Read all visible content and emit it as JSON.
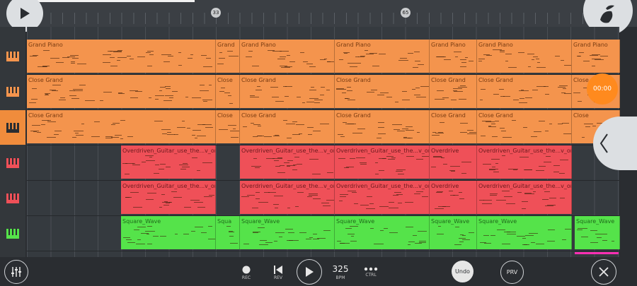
{
  "ruler": {
    "markers": [
      "33",
      "65"
    ]
  },
  "tracks": [
    {
      "icon": "piano-icon",
      "color": "#f4944d"
    },
    {
      "icon": "piano-icon",
      "color": "#f4944d"
    },
    {
      "icon": "piano-icon",
      "color": "#f4944d"
    },
    {
      "icon": "piano-icon",
      "color": "#ef5058"
    },
    {
      "icon": "piano-icon",
      "color": "#ef5058"
    },
    {
      "icon": "piano-icon",
      "color": "#55e34a"
    }
  ],
  "clip_names": {
    "grand_piano": "Grand Piano",
    "grand_short": "Grand",
    "close_grand": "Close Grand",
    "close_short": "Close",
    "guitar": "Overdriven_Guitar_use_the...v_one",
    "guitar_short": "Overdrive",
    "square": "Square_Wave",
    "square_short": "Squa"
  },
  "timer": "00:00",
  "bottom": {
    "rec": "REC",
    "rev": "REV",
    "bpm_value": "325",
    "bpm": "BPM",
    "ctrl": "CTRL",
    "undo": "Undo",
    "prv": "PRV"
  }
}
